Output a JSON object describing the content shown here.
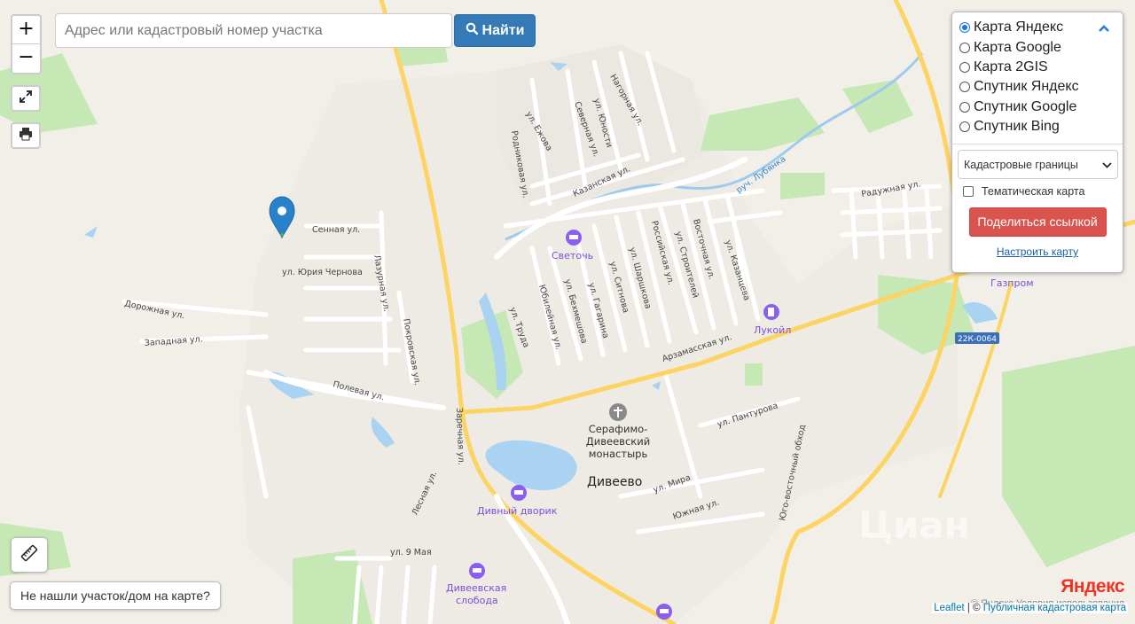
{
  "controls": {
    "zoom_in": "+",
    "zoom_out": "−"
  },
  "search": {
    "placeholder": "Адрес или кадастровый номер участка",
    "button_label": "Найти"
  },
  "layers": {
    "base_maps": [
      {
        "label": "Карта Яндекс",
        "selected": true
      },
      {
        "label": "Карта Google",
        "selected": false
      },
      {
        "label": "Карта 2GIS",
        "selected": false
      },
      {
        "label": "Спутник Яндекс",
        "selected": false
      },
      {
        "label": "Спутник Google",
        "selected": false
      },
      {
        "label": "Спутник Bing",
        "selected": false
      }
    ],
    "overlay_select": "Кадастровые границы",
    "thematic_label": "Тематическая карта",
    "thematic_checked": false,
    "share_label": "Поделиться ссылкой",
    "setup_label": "Настроить карту"
  },
  "not_found_label": "Не нашли участок/дом на карте?",
  "map": {
    "town": "Дивеево",
    "monastery": "Серафимо-\nДивеевский\nмонастырь",
    "monastery_lines": [
      "Серафимо-",
      "Дивеевский",
      "монастырь"
    ],
    "pois": [
      "Светочь",
      "Лукойл",
      "Газпром",
      "Дивный дворик",
      "Дивеевская",
      "слобода"
    ],
    "road_badge": "22К-0064",
    "stream": "руч. Лубянка",
    "streets": {
      "s1": "Сенная ул.",
      "s2": "ул. Юрия Чернова",
      "s3": "Дорожная ул.",
      "s4": "Западная ул.",
      "s5": "Полевая ул.",
      "s6": "Лазурная ул.",
      "s7": "Покровская ул.",
      "s8": "Заречная ул.",
      "s9": "Лесная ул.",
      "s10": "ул. 9 Мая",
      "s11": "ул. Ежова",
      "s12": "Родниковая ул.",
      "s13": "Северная ул.",
      "s14": "ул. Юности",
      "s15": "Нагорная ул.",
      "s16": "Казанская ул.",
      "s17": "ул. Труда",
      "s18": "Юбилейная ул.",
      "s19": "ул. Бехмешова",
      "s20": "ул. Гагарина",
      "s21": "ул. Ситнова",
      "s22": "ул. Шаршкова",
      "s23": "Российская ул.",
      "s24": "ул. Строителей",
      "s25": "Восточная ул.",
      "s26": "ул. Казанцева",
      "s27": "Арзамасская ул.",
      "s28": "ул. Пантурова",
      "s29": "ул. Мира",
      "s30": "Южная ул.",
      "s31": "Юго-восточный обход",
      "s32": "Радужная ул."
    }
  },
  "branding": {
    "yandex_logo": "Яндекс",
    "yandex_terms": "© Яндекс Условия использования",
    "leaflet": "Leaflet",
    "separator": " | © ",
    "cadastral": "Публичная кадастровая карта",
    "watermark": "Циан"
  },
  "colors": {
    "accent_blue": "#337ab7",
    "share_red": "#d9534f",
    "road_yellow": "#fcd462",
    "water": "#aad3f1",
    "park": "#c5e8b4",
    "poi_purple": "#8c5ef0"
  }
}
